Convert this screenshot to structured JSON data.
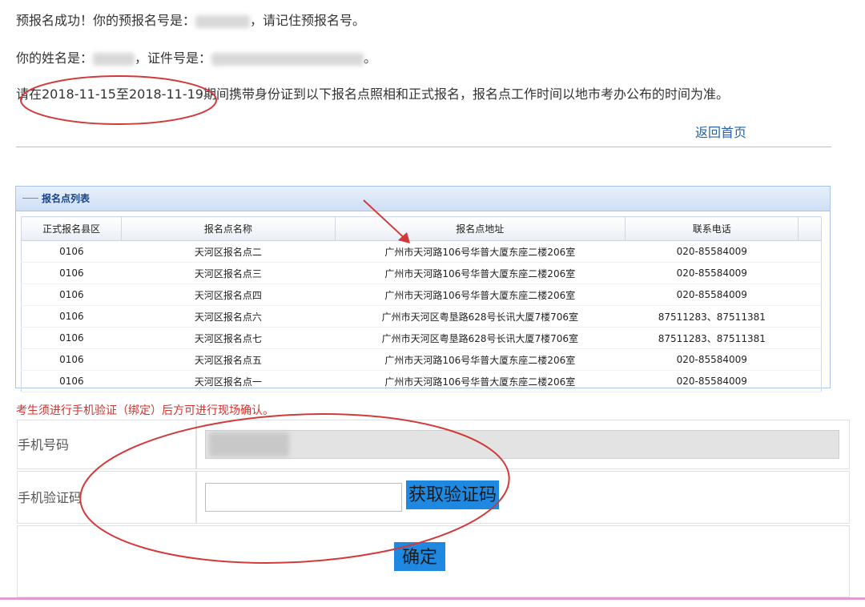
{
  "messages": {
    "line1_prefix": "预报名成功！你的预报名号是：",
    "line1_suffix": "，请记住预报名号。",
    "line2_prefix": "你的姓名是：",
    "line2_mid": "，证件号是：",
    "line2_suffix": "。",
    "line3": "请在2018-11-15至2018-11-19期间携带身份证到以下报名点照相和正式报名，报名点工作时间以地市考办公布的时间为准。"
  },
  "back_link": "返回首页",
  "panel": {
    "title": "报名点列表",
    "columns": [
      "正式报名县区",
      "报名点名称",
      "报名点地址",
      "联系电话"
    ],
    "rows": [
      [
        "0106",
        "天河区报名点二",
        "广州市天河路106号华普大厦东座二楼206室",
        "020-85584009"
      ],
      [
        "0106",
        "天河区报名点三",
        "广州市天河路106号华普大厦东座二楼206室",
        "020-85584009"
      ],
      [
        "0106",
        "天河区报名点四",
        "广州市天河路106号华普大厦东座二楼206室",
        "020-85584009"
      ],
      [
        "0106",
        "天河区报名点六",
        "广州市天河区粤垦路628号长讯大厦7楼706室",
        "87511283、87511381"
      ],
      [
        "0106",
        "天河区报名点七",
        "广州市天河区粤垦路628号长讯大厦7楼706室",
        "87511283、87511381"
      ],
      [
        "0106",
        "天河区报名点五",
        "广州市天河路106号华普大厦东座二楼206室",
        "020-85584009"
      ],
      [
        "0106",
        "天河区报名点一",
        "广州市天河路106号华普大厦东座二楼206室",
        "020-85584009"
      ]
    ]
  },
  "notice": "考生须进行手机验证（绑定）后方可进行现场确认。",
  "form": {
    "phone_label": "手机号码",
    "code_label": "手机验证码",
    "get_code_button": "获取验证码",
    "confirm_button": "确定"
  },
  "colors": {
    "link": "#2a62a8",
    "notice": "#d4322e",
    "button": "#1f88e0",
    "annotation": "#d23a3a"
  }
}
